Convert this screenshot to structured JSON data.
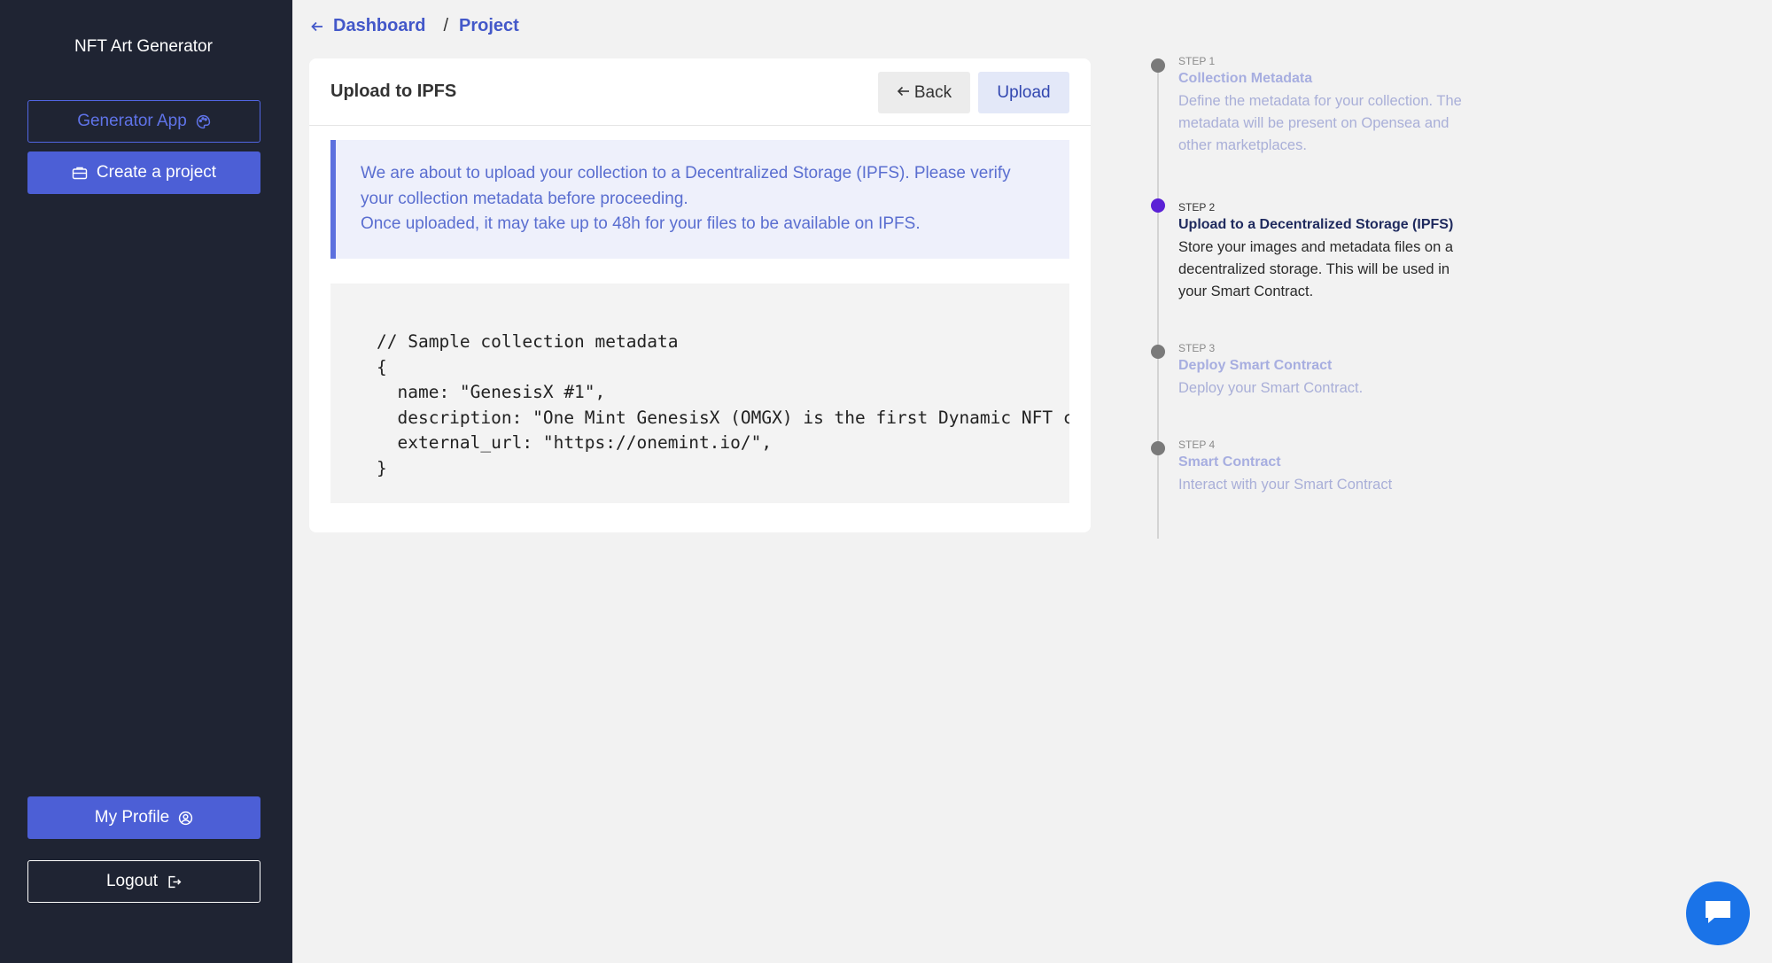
{
  "sidebar": {
    "brand": "NFT Art Generator",
    "generator_app_label": "Generator App",
    "create_project_label": "Create a project",
    "profile_label": "My Profile",
    "logout_label": "Logout"
  },
  "breadcrumb": {
    "dashboard": "Dashboard",
    "separator": "/",
    "project": "Project"
  },
  "card": {
    "title": "Upload to IPFS",
    "back_label": "Back",
    "upload_label": "Upload",
    "notice_line1": "We are about to upload your collection to a Decentralized Storage (IPFS). Please verify your collection metadata before proceeding.",
    "notice_line2": "Once uploaded, it may take up to 48h for your files to be available on IPFS.",
    "code": "// Sample collection metadata\n{\n  name: \"GenesisX #1\",\n  description: \"One Mint GenesisX (OMGX) is the first Dynamic NFT collection\",\n  external_url: \"https://onemint.io/\",\n}"
  },
  "steps": [
    {
      "label": "STEP 1",
      "title": "Collection Metadata",
      "desc": "Define the metadata for your collection. The metadata will be present on Opensea and other marketplaces."
    },
    {
      "label": "STEP 2",
      "title": "Upload to a Decentralized Storage (IPFS)",
      "desc": "Store your images and metadata files on a decentralized storage. This will be used in your Smart Contract."
    },
    {
      "label": "STEP 3",
      "title": "Deploy Smart Contract",
      "desc": "Deploy your Smart Contract."
    },
    {
      "label": "STEP 4",
      "title": "Smart Contract",
      "desc": "Interact with your Smart Contract"
    }
  ],
  "active_step": 2,
  "colors": {
    "sidebar_bg": "#1f2433",
    "primary": "#4c5fd6",
    "active_step_dot": "#5b21d6",
    "chat_button": "#1a73e8"
  },
  "icons": [
    "palette-icon",
    "briefcase-icon",
    "user-circle-icon",
    "logout-icon",
    "arrow-left-icon",
    "chat-icon"
  ]
}
